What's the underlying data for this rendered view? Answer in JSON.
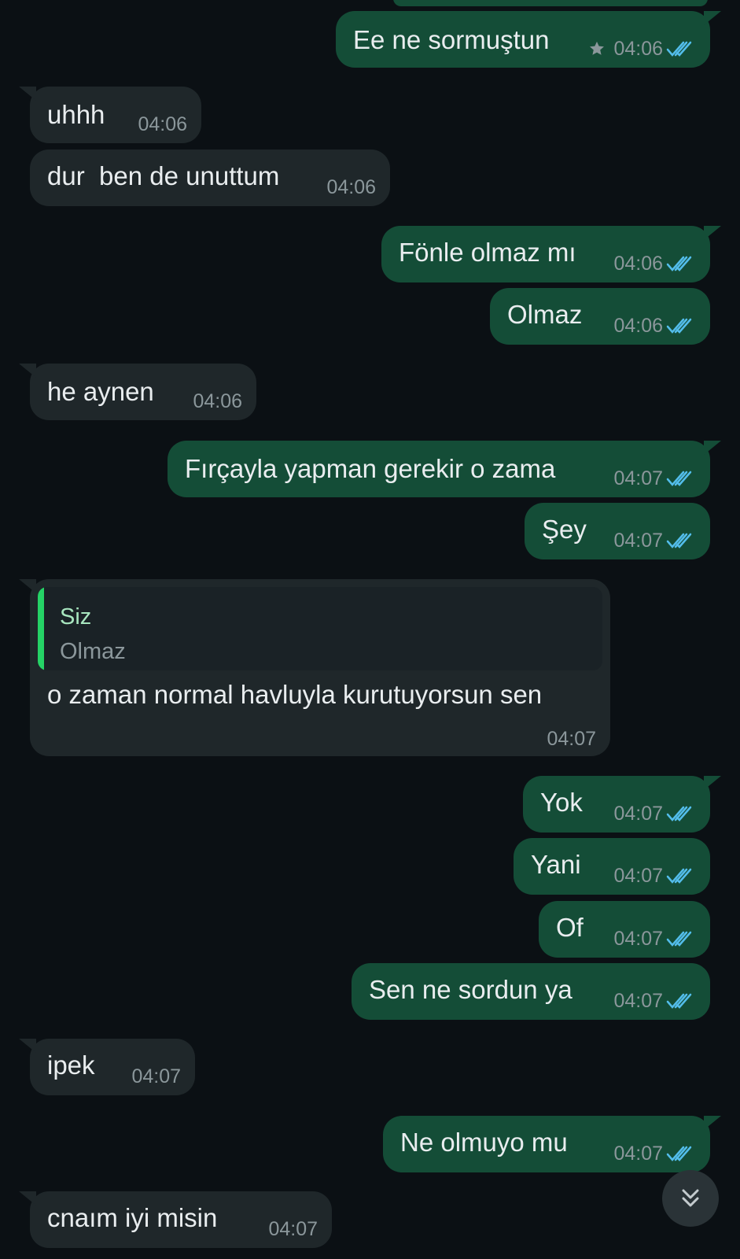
{
  "colors": {
    "background": "#0b1014",
    "outgoing_bubble": "#144d37",
    "incoming_bubble": "#1f272a",
    "text": "#e9edef",
    "meta_text": "#8b979b",
    "read_ticks": "#53bdeb",
    "quote_bar": "#25d366"
  },
  "messages": [
    {
      "text": "Ee ne sormuştun",
      "time": "04:06",
      "direction": "outgoing",
      "starred": true,
      "status": "read"
    },
    {
      "text": "uhhh",
      "time": "04:06",
      "direction": "incoming"
    },
    {
      "text": "dur  ben de unuttum",
      "time": "04:06",
      "direction": "incoming"
    },
    {
      "text": "Fönle olmaz mı",
      "time": "04:06",
      "direction": "outgoing",
      "status": "read"
    },
    {
      "text": "Olmaz",
      "time": "04:06",
      "direction": "outgoing",
      "status": "read"
    },
    {
      "text": "he aynen",
      "time": "04:06",
      "direction": "incoming"
    },
    {
      "text": "Fırçayla yapman gerekir o zama",
      "time": "04:07",
      "direction": "outgoing",
      "status": "read"
    },
    {
      "text": "Şey",
      "time": "04:07",
      "direction": "outgoing",
      "status": "read"
    },
    {
      "text": "o zaman normal havluyla kurutuyorsun sen",
      "time": "04:07",
      "direction": "incoming",
      "quote": {
        "author": "Siz",
        "text": "Olmaz"
      }
    },
    {
      "text": "Yok",
      "time": "04:07",
      "direction": "outgoing",
      "status": "read"
    },
    {
      "text": "Yani",
      "time": "04:07",
      "direction": "outgoing",
      "status": "read"
    },
    {
      "text": "Of",
      "time": "04:07",
      "direction": "outgoing",
      "status": "read"
    },
    {
      "text": "Sen ne sordun ya",
      "time": "04:07",
      "direction": "outgoing",
      "status": "read"
    },
    {
      "text": "ipek",
      "time": "04:07",
      "direction": "incoming"
    },
    {
      "text": "Ne olmuyo mu",
      "time": "04:07",
      "direction": "outgoing",
      "status": "read"
    },
    {
      "text": "cnaım iyi misin",
      "time": "04:07",
      "direction": "incoming"
    }
  ],
  "icons": {
    "scroll_down": "double-chevron-down-icon",
    "read_receipt": "double-check-icon",
    "starred": "star-icon"
  }
}
